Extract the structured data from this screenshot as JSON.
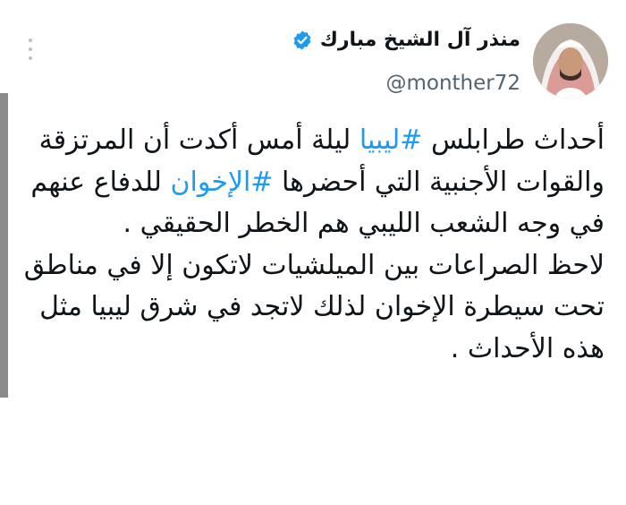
{
  "author": {
    "display_name": "منذر آل الشيخ مبارك",
    "handle": "@monther72",
    "verified_color": "#1d9bf0"
  },
  "tweet": {
    "para1_pre": "أحداث طرابلس ",
    "hashtag1": "#ليبيا",
    "para1_mid": " ليلة أمس أكدت أن المرتزقة والقوات الأجنبية التي أحضرها ",
    "hashtag2": "#الإخوان",
    "para1_post": " للدفاع عنهم في وجه الشعب الليبي هم الخطر الحقيقي .",
    "para2": "لاحظ الصراعات بين الميلشيات لاتكون إلا في مناطق تحت سيطرة الإخوان لذلك لاتجد في شرق ليبيا مثل هذه الأحداث ."
  },
  "colors": {
    "text": "#0f1419",
    "secondary": "#536471",
    "link": "#1d9bf0"
  }
}
